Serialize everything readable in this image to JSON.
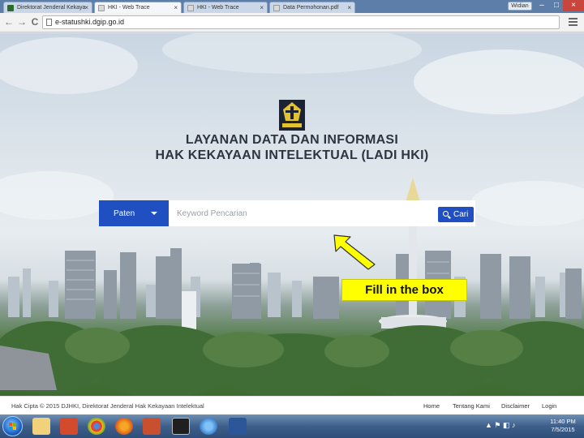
{
  "browser": {
    "tabs": [
      {
        "label": "Direktorat Jenderal Kekaya",
        "close": "×"
      },
      {
        "label": "HKI - Web Trace",
        "close": "×"
      },
      {
        "label": "HKI - Web Trace",
        "close": "×"
      },
      {
        "label": "Data Permohonan.pdf",
        "close": "×"
      }
    ],
    "user_badge": "Widian",
    "window_controls": {
      "minimize": "–",
      "maximize": "□",
      "close": "×"
    },
    "nav": {
      "back": "←",
      "forward": "→",
      "reload": "C"
    },
    "url": "e-statushki.dgip.go.id"
  },
  "header": {
    "title_line1": "LAYANAN DATA DAN INFORMASI",
    "title_line2": "HAK KEKAYAAN INTELEKTUAL (LADI HKI)"
  },
  "search": {
    "category_selected": "Paten",
    "keyword_placeholder": "Keyword Pencarian",
    "keyword_value": "",
    "button_label": "Cari"
  },
  "annotation": {
    "callout_text": "Fill in the box",
    "arrow_color": "#ffff00"
  },
  "footer": {
    "copyright": "Hak Cipta © 2015 DJHKI, Direktorat Jenderal Hak Kekayaan Intelektual",
    "links": [
      "Home",
      "Tentang Kami",
      "Disclaimer",
      "Login"
    ]
  },
  "taskbar": {
    "clock_time": "11:40 PM",
    "clock_date": "7/5/2015"
  },
  "colors": {
    "accent": "#1f4fc1",
    "callout": "#ffff00",
    "title_text": "#2e3440"
  },
  "icons": {
    "search_button": "search-icon",
    "category_dropdown": "caret-down-icon",
    "logo": "ministry-emblem-icon"
  }
}
